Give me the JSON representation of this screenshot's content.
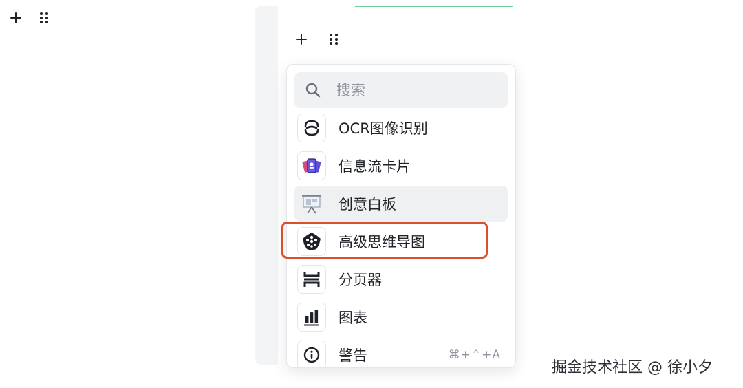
{
  "toolbar": {
    "add_icon": "plus-icon",
    "drag_icon": "drag-handle-icon"
  },
  "editor_toolbar": {
    "add_icon": "plus-icon",
    "drag_icon": "drag-handle-icon"
  },
  "search": {
    "placeholder": "搜索",
    "icon": "search-icon"
  },
  "menu": {
    "items": [
      {
        "label": "OCR图像识别",
        "icon": "ocr-icon"
      },
      {
        "label": "信息流卡片",
        "icon": "feed-card-icon"
      },
      {
        "label": "创意白板",
        "icon": "whiteboard-icon",
        "hovered": true
      },
      {
        "label": "高级思维导图",
        "icon": "mindmap-icon",
        "highlighted": true
      },
      {
        "label": "分页器",
        "icon": "paginator-icon"
      },
      {
        "label": "图表",
        "icon": "chart-icon"
      },
      {
        "label": "警告",
        "icon": "alert-icon",
        "shortcut": "⌘+⇧+A"
      }
    ]
  },
  "watermark": "掘金技术社区 @ 徐小夕",
  "colors": {
    "highlight_border": "#d9502e",
    "hover_bg": "#eff0f2",
    "search_bg": "#f0f1f3",
    "accent_green": "#6fcf97"
  }
}
